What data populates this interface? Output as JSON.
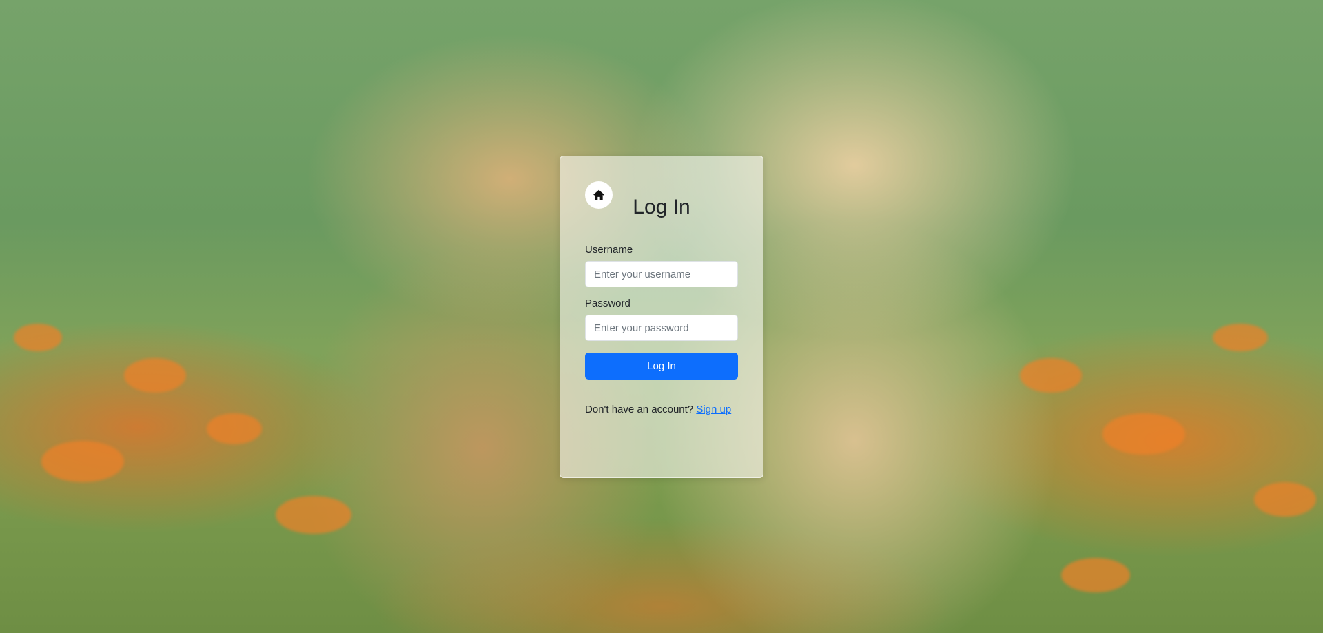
{
  "background": {
    "description_icon": "puppies-photo-background"
  },
  "login_card": {
    "home_icon": "home-icon",
    "title": "Log In",
    "username": {
      "label": "Username",
      "placeholder": "Enter your username",
      "value": ""
    },
    "password": {
      "label": "Password",
      "placeholder": "Enter your password",
      "value": ""
    },
    "submit_label": "Log In",
    "signup_prompt": "Don't have an account?",
    "signup_link": "Sign up"
  },
  "colors": {
    "primary": "#0d6efd",
    "text": "#212529",
    "card_bg": "rgba(255,255,255,0.55)"
  }
}
